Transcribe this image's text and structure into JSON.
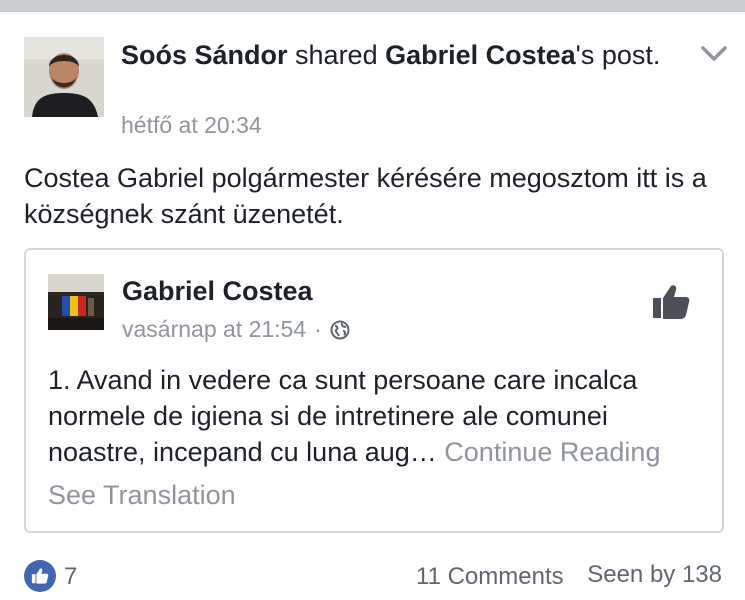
{
  "post": {
    "author": "Soós Sándor",
    "shared_text": " shared ",
    "original_author": "Gabriel Costea",
    "suffix": "'s post.",
    "timestamp": "hétfő at 20:34",
    "message": "Costea Gabriel polgármester kérésére megosztom itt is a községnek szánt üzenetét."
  },
  "shared_post": {
    "author": "Gabriel Costea",
    "timestamp": "vasárnap at 21:54",
    "separator": "·",
    "body": "1. Avand in vedere ca sunt persoane care incalca normele de igiena si de intretinere ale comunei noastre, incepand cu luna aug…",
    "continue_label": "Continue Reading",
    "see_translation": "See Translation"
  },
  "footer": {
    "likes": "7",
    "comments": "11 Comments",
    "seen": "Seen by 138"
  },
  "icons": {
    "chevron": "chevron-down-icon",
    "globe": "globe-icon",
    "like_page": "thumbs-up-icon",
    "like_badge": "like-icon"
  },
  "colors": {
    "text": "#1d2129",
    "secondary": "#90949c",
    "accent": "#4267b2",
    "border": "#d3d6db"
  }
}
